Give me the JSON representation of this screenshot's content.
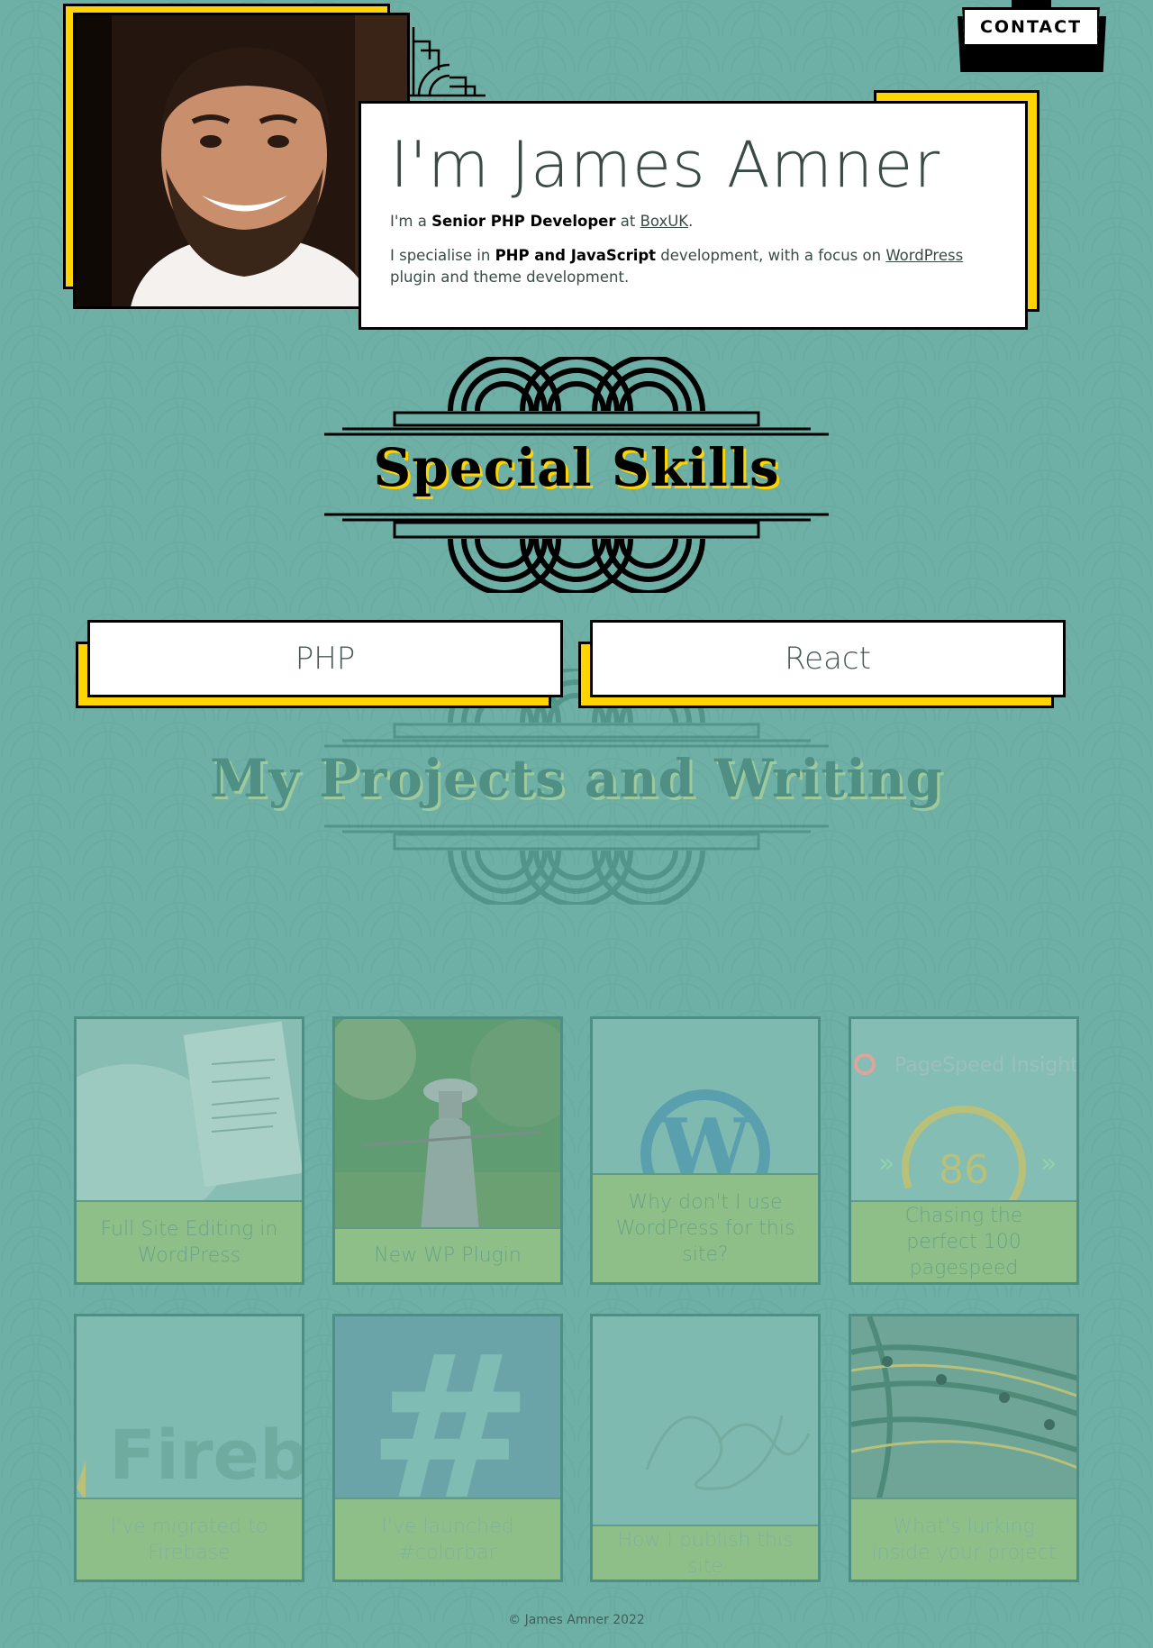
{
  "nav": {
    "contact_label": "CONTACT"
  },
  "intro": {
    "heading": "I'm James Amner",
    "line1_prefix": "I'm a ",
    "line1_role": "Senior PHP Developer",
    "line1_mid": " at ",
    "line1_company": "BoxUK",
    "line1_suffix": ".",
    "line2_prefix": "I specialise in ",
    "line2_skills": "PHP and JavaScript",
    "line2_mid": " development, with a focus on ",
    "line2_link": "WordPress",
    "line2_suffix": " plugin and theme development."
  },
  "skills": {
    "heading": "Special Skills",
    "items": [
      "PHP",
      "React"
    ]
  },
  "projects": {
    "heading": "My Projects and Writing",
    "items": [
      {
        "title": "Full Site Editing in WordPress",
        "thumb": "laptop-photo"
      },
      {
        "title": "New WP Plugin",
        "thumb": "farmer-photo"
      },
      {
        "title": "Why don't I use WordPress for this site?",
        "thumb": "wordpress-logo"
      },
      {
        "title": "Chasing the perfect 100 pagespeed",
        "thumb": "pagespeed-score",
        "thumb_text": "PageSpeed Insights",
        "score": "86"
      },
      {
        "title": "I've migrated to Firebase",
        "thumb": "firebase-logo",
        "thumb_text": "Fireba"
      },
      {
        "title": "I've launched #colorbar",
        "thumb": "hash-symbol",
        "thumb_text": "#"
      },
      {
        "title": "How I publish this site",
        "thumb": "script-lettering"
      },
      {
        "title": "What's lurking inside your project",
        "thumb": "cables-photo"
      }
    ]
  },
  "footer": {
    "text": "© James Amner 2022"
  },
  "colors": {
    "background": "#6fb0a6",
    "accent": "#ffd400",
    "card": "#ffffff",
    "label_green": "#8fbf89"
  }
}
